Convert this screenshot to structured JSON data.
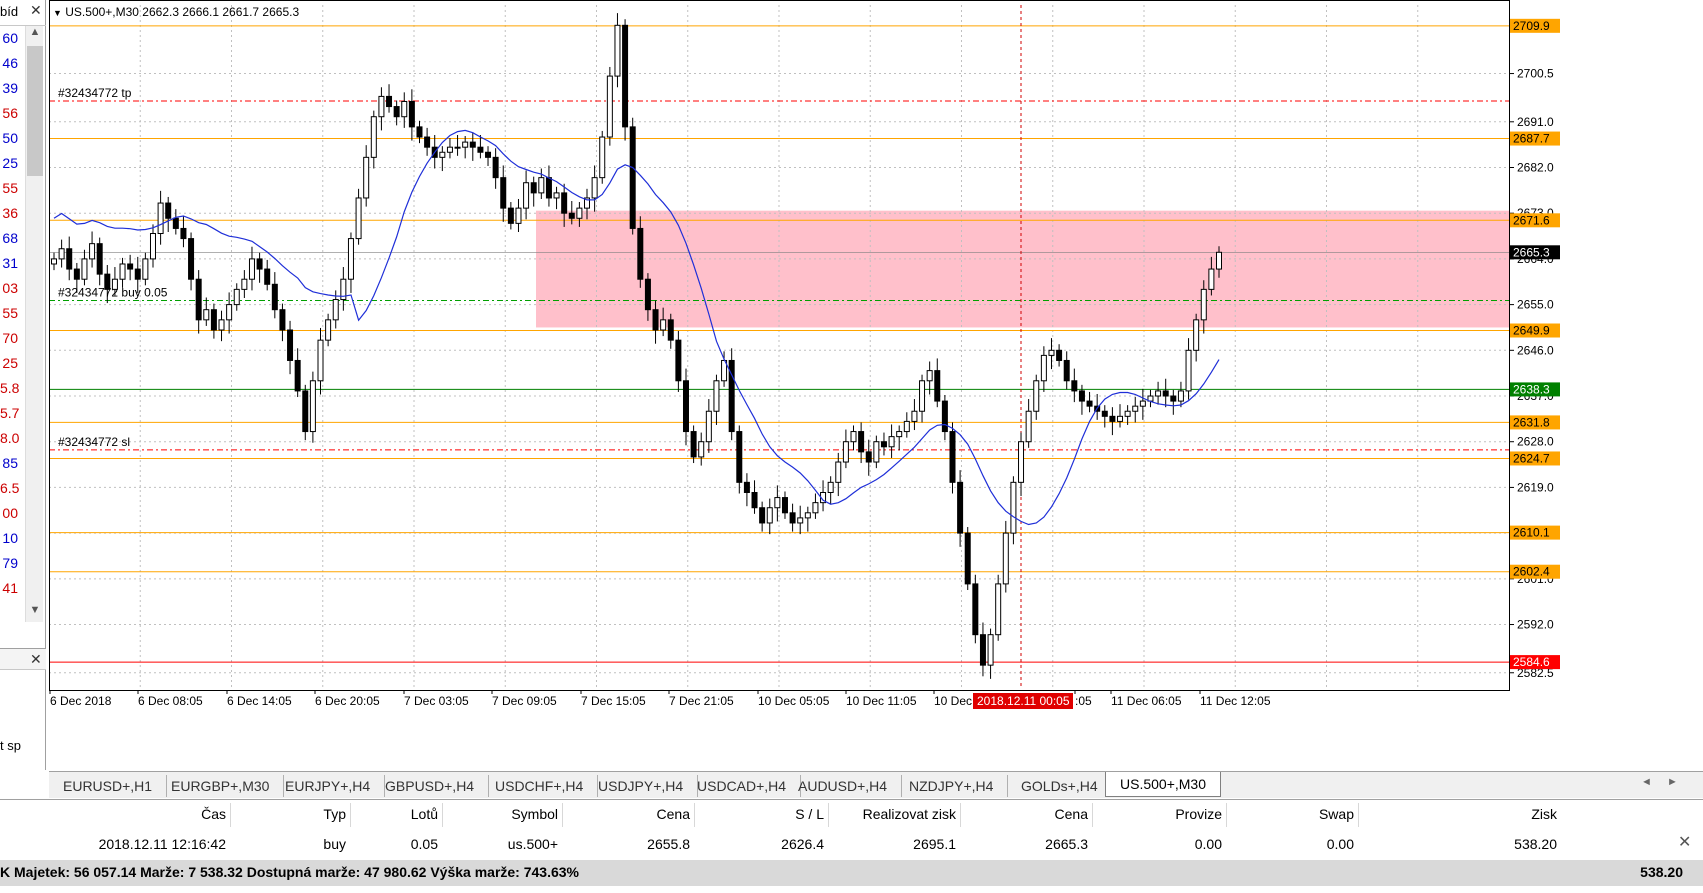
{
  "market_watch": {
    "header_fragment": "bíd",
    "rows": [
      {
        "text": "60",
        "color": "#0000cc"
      },
      {
        "text": "46",
        "color": "#0000cc"
      },
      {
        "text": "39",
        "color": "#0000cc"
      },
      {
        "text": "56",
        "color": "#cc0000"
      },
      {
        "text": "50",
        "color": "#0000cc"
      },
      {
        "text": "25",
        "color": "#0000cc"
      },
      {
        "text": "55",
        "color": "#cc0000"
      },
      {
        "text": "36",
        "color": "#cc0000"
      },
      {
        "text": "68",
        "color": "#0000cc"
      },
      {
        "text": "31",
        "color": "#0000cc"
      },
      {
        "text": "03",
        "color": "#cc0000"
      },
      {
        "text": "55",
        "color": "#cc0000"
      },
      {
        "text": "70",
        "color": "#cc0000"
      },
      {
        "text": "25",
        "color": "#cc0000"
      },
      {
        "text": "5.8",
        "color": "#cc0000"
      },
      {
        "text": "5.7",
        "color": "#cc0000"
      },
      {
        "text": "8.0",
        "color": "#cc0000"
      },
      {
        "text": "85",
        "color": "#0000cc"
      },
      {
        "text": "6.5",
        "color": "#cc0000"
      },
      {
        "text": "00",
        "color": "#cc0000"
      },
      {
        "text": "10",
        "color": "#0000cc"
      },
      {
        "text": "79",
        "color": "#0000cc"
      },
      {
        "text": "41",
        "color": "#cc0000"
      }
    ],
    "navigator_fragment": "t sp"
  },
  "chart": {
    "symbol_info": "US.500+,M30  2662.3 2666.1 2661.7 2665.3",
    "price_range": [
      2579.5,
      2714.0
    ],
    "y_ticks": [
      "2700.5",
      "2691.0",
      "2682.0",
      "2673.0",
      "2664.0",
      "2655.0",
      "2646.0",
      "2637.0",
      "2628.0",
      "2619.0",
      "2610.0",
      "2601.0",
      "2592.0",
      "2582.5"
    ],
    "x_ticks": [
      "6 Dec 2018",
      "6 Dec 08:05",
      "6 Dec 14:05",
      "6 Dec 20:05",
      "7 Dec 03:05",
      "7 Dec 09:05",
      "7 Dec 15:05",
      "7 Dec 21:05",
      "10 Dec 05:05",
      "10 Dec 11:05",
      "10 Dec",
      ":05",
      "11 Dec 06:05",
      "11 Dec 12:05"
    ],
    "cursor_time_label": "2018.12.11 00:05",
    "current_price": "2665.3",
    "levels": [
      {
        "price": 2709.9,
        "label": "2709.9",
        "color": "#ffa500"
      },
      {
        "price": 2687.7,
        "label": "2687.7",
        "color": "#ffa500"
      },
      {
        "price": 2671.6,
        "label": "2671.6",
        "color": "#ffa500"
      },
      {
        "price": 2649.9,
        "label": "2649.9",
        "color": "#ffa500"
      },
      {
        "price": 2631.8,
        "label": "2631.8",
        "color": "#ffa500"
      },
      {
        "price": 2624.7,
        "label": "2624.7",
        "color": "#ffa500"
      },
      {
        "price": 2610.1,
        "label": "2610.1",
        "color": "#ffa500"
      },
      {
        "price": 2602.4,
        "label": "2602.4",
        "color": "#ffa500"
      },
      {
        "price": 2584.6,
        "label": "2584.6",
        "color": "#ff0000"
      },
      {
        "price": 2638.3,
        "label": "2638.3",
        "color": "#008000"
      }
    ],
    "order_lines": [
      {
        "price": 2695.1,
        "label": "#32434772 tp",
        "color": "#ff0000"
      },
      {
        "price": 2655.8,
        "label": "#32434772 buy 0.05",
        "color": "#00a000"
      },
      {
        "price": 2626.4,
        "label": "#32434772 sl",
        "color": "#ff0000"
      }
    ],
    "zone": {
      "price_top": 2673.5,
      "price_bottom": 2650.5,
      "color": "#ffc0cb"
    },
    "ma_color": "#1f2fd8",
    "colors": {
      "bull": "#ffffff",
      "bear": "#000000",
      "grid": "#c0c0c0"
    }
  },
  "tabs": {
    "items": [
      "EURUSD+,H1",
      "EURGBP+,M30",
      "EURJPY+,H4",
      "GBPUSD+,H4",
      "USDCHF+,H4",
      "USDJPY+,H4",
      "USDCAD+,H4",
      "AUDUSD+,H4",
      "NZDJPY+,H4",
      "GOLDs+,H4",
      "US.500+,M30"
    ],
    "active_index": 10
  },
  "terminal": {
    "headers": [
      "Čas",
      "Typ",
      "Lotů",
      "Symbol",
      "Cena",
      "S / L",
      "Realizovat zisk",
      "Cena",
      "Provize",
      "Swap",
      "Zisk"
    ],
    "row": [
      "2018.12.11 12:16:42",
      "buy",
      "0.05",
      "us.500+",
      "2655.8",
      "2626.4",
      "2695.1",
      "2665.3",
      "0.00",
      "0.00",
      "538.20"
    ],
    "balance_line": "K  Majetek: 56 057.14  Marže: 7 538.32  Dostupná marže: 47 980.62  Výška marže: 743.63%",
    "total_profit": "538.20"
  }
}
